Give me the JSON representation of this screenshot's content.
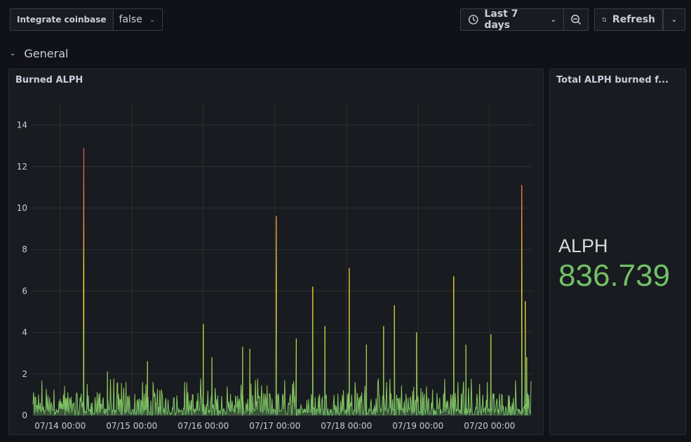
{
  "variables": {
    "label": "Integrate coinbase",
    "value": "false"
  },
  "time_picker": {
    "range_label": "Last 7 days",
    "refresh_label": "Refresh"
  },
  "row": {
    "title": "General"
  },
  "timeseries_panel": {
    "title": "Burned ALPH"
  },
  "stat_panel": {
    "title": "Total ALPH burned f...",
    "prefix": "ALPH",
    "value": "836.739",
    "value_color": "#73bf69"
  },
  "chart_data": {
    "type": "line",
    "title": "Burned ALPH",
    "xlabel": "",
    "ylabel": "",
    "x_ticks": [
      "07/14 00:00",
      "07/15 00:00",
      "07/16 00:00",
      "07/17 00:00",
      "07/18 00:00",
      "07/19 00:00",
      "07/20 00:00"
    ],
    "y_ticks": [
      0,
      2,
      4,
      6,
      8,
      10,
      12,
      14
    ],
    "ylim": [
      0,
      15
    ],
    "xlim_days": [
      -0.4,
      6.6
    ],
    "grid": true,
    "legend": "none",
    "color_scheme": "gradient green-yellow-red by value",
    "colors": {
      "low": "#73bf69",
      "mid": "#fade2a",
      "high": "#f2495c"
    },
    "series": [
      {
        "note_x": "x in days since 07/14 00:00",
        "peaks": [
          {
            "x": 0.33,
            "y": 12.9
          },
          {
            "x": 0.66,
            "y": 2.1
          },
          {
            "x": 1.22,
            "y": 2.6
          },
          {
            "x": 2.0,
            "y": 4.4
          },
          {
            "x": 2.12,
            "y": 2.8
          },
          {
            "x": 2.55,
            "y": 3.3
          },
          {
            "x": 2.65,
            "y": 3.2
          },
          {
            "x": 3.02,
            "y": 9.6
          },
          {
            "x": 3.3,
            "y": 3.7
          },
          {
            "x": 3.53,
            "y": 6.2
          },
          {
            "x": 3.7,
            "y": 4.3
          },
          {
            "x": 4.04,
            "y": 7.1
          },
          {
            "x": 4.28,
            "y": 3.4
          },
          {
            "x": 4.52,
            "y": 4.3
          },
          {
            "x": 4.67,
            "y": 5.3
          },
          {
            "x": 4.98,
            "y": 4.0
          },
          {
            "x": 5.5,
            "y": 6.7
          },
          {
            "x": 5.67,
            "y": 3.4
          },
          {
            "x": 6.02,
            "y": 3.9
          },
          {
            "x": 6.45,
            "y": 11.1
          },
          {
            "x": 6.5,
            "y": 5.5
          },
          {
            "x": 6.52,
            "y": 2.8
          }
        ],
        "baseline_range": [
          0,
          1.8
        ]
      }
    ]
  }
}
